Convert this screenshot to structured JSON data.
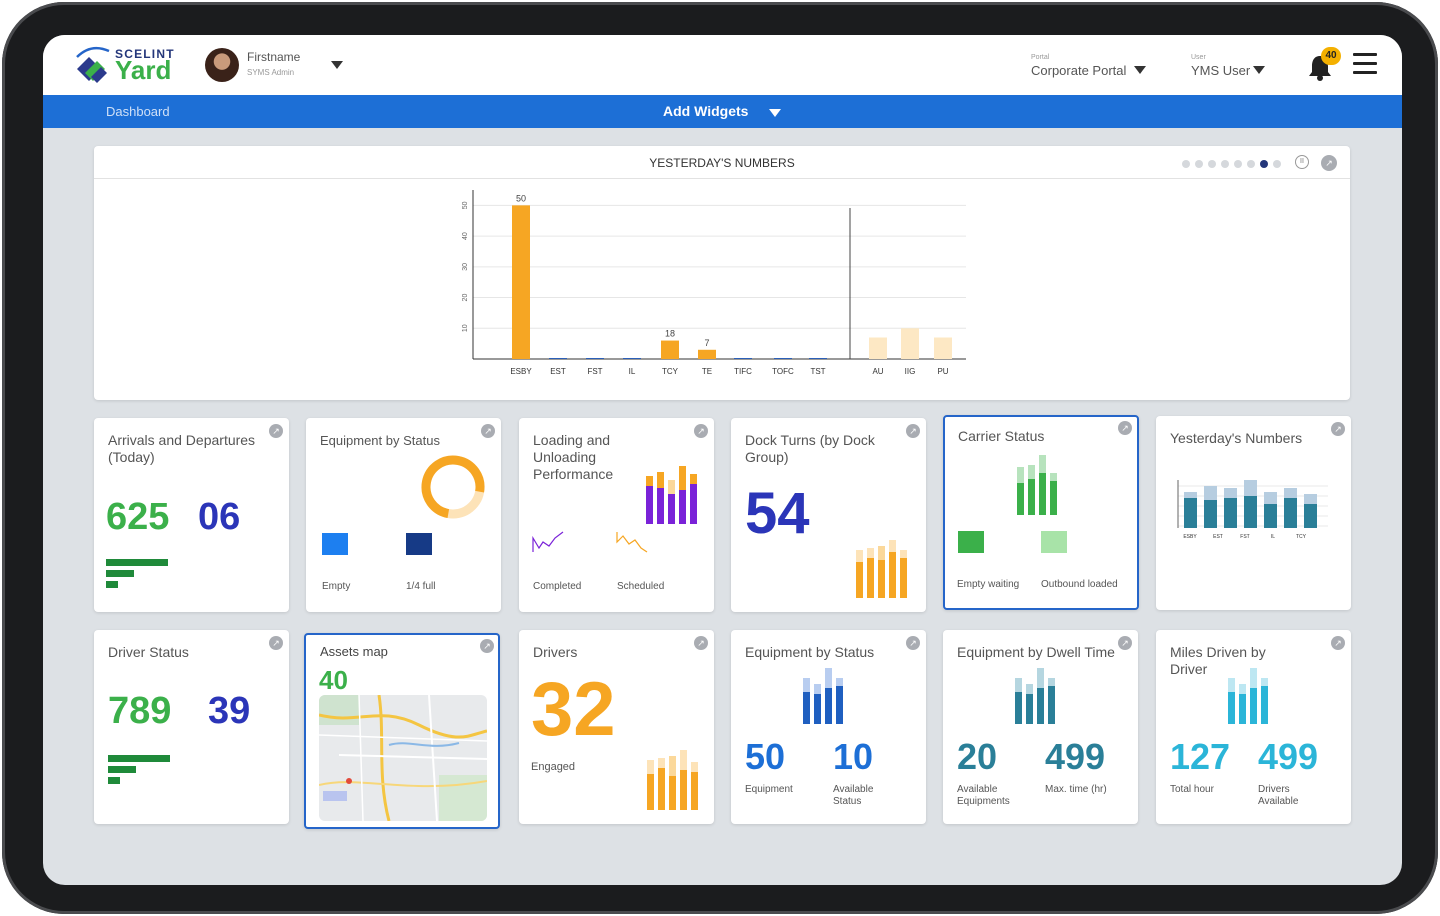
{
  "header": {
    "brand_small": "SCELINT",
    "brand_name": "Yard",
    "user_name": "Firstname",
    "user_role": "SYMS Admin",
    "portal_label": "Portal",
    "portal_value": "Corporate Portal",
    "user_label": "User",
    "user_value": "YMS User",
    "notification_count": "40"
  },
  "nav": {
    "breadcrumb": "Dashboard",
    "add_widgets": "Add Widgets"
  },
  "main_chart": {
    "title": "YESTERDAY'S NUMBERS",
    "carousel_dots": 8,
    "active_dot": 7
  },
  "chart_data": {
    "type": "bar",
    "categories": [
      "ESBY",
      "EST",
      "FST",
      "IL",
      "TCY",
      "TE",
      "TIFC",
      "TOFC",
      "TST",
      "AU",
      "IIG",
      "PU"
    ],
    "values": [
      50,
      0,
      0,
      0,
      6,
      3,
      0,
      0,
      0,
      7,
      10,
      7
    ],
    "data_labels": [
      "50",
      "",
      "",
      "",
      "18",
      "7",
      "",
      "",
      "",
      "",
      "",
      ""
    ],
    "y_ticks": [
      "10",
      "20",
      "30",
      "40",
      "50"
    ],
    "ylim": [
      0,
      55
    ],
    "colors": {
      "primary": "#f6a623",
      "faded": "#fde8c4"
    },
    "faded_categories": [
      "AU",
      "IIG",
      "PU"
    ]
  },
  "widgets": {
    "arrivals": {
      "title": "Arrivals and Departures (Today)",
      "v1": "625",
      "v2": "06"
    },
    "equip_status": {
      "title": "Equipment by Status",
      "legend1": "Empty",
      "legend2": "1/4 full"
    },
    "loading": {
      "title": "Loading and Unloading Performance",
      "legend1": "Completed",
      "legend2": "Scheduled"
    },
    "dock_turns": {
      "title": "Dock Turns (by Dock Group)",
      "value": "54"
    },
    "carrier": {
      "title": "Carrier Status",
      "legend1": "Empty waiting",
      "legend2": "Outbound loaded"
    },
    "yesterday_small": {
      "title": "Yesterday's Numbers",
      "labels": [
        "ESBY",
        "EST",
        "FST",
        "IL",
        "TCY"
      ]
    },
    "driver_status": {
      "title": "Driver Status",
      "v1": "789",
      "v2": "39"
    },
    "assets_map": {
      "title": "Assets map",
      "value": "40"
    },
    "drivers": {
      "title": "Drivers",
      "value": "32",
      "label": "Engaged"
    },
    "equip_status2": {
      "title": "Equipment by Status",
      "v1": "50",
      "v2": "10",
      "l1": "Equipment",
      "l2": "Available Status"
    },
    "dwell": {
      "title": "Equipment by Dwell Time",
      "v1": "20",
      "v2": "499",
      "l1": "Available Equipments",
      "l2": "Max. time (hr)"
    },
    "miles": {
      "title": "Miles Driven by Driver",
      "v1": "127",
      "v2": "499",
      "l1": "Total hour",
      "l2": "Drivers Available"
    }
  },
  "colors": {
    "green": "#3bb04a",
    "navy": "#2b35b8",
    "orange": "#f6a623",
    "blue": "#1d6fd6",
    "teal": "#2a7f98",
    "cyan": "#2bb5d8"
  }
}
